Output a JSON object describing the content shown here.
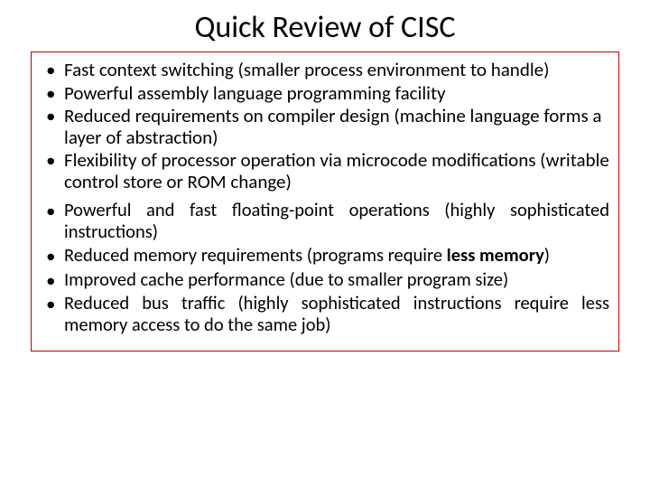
{
  "title": "Quick Review of CISC",
  "bullets_a": [
    "Fast context switching (smaller process environment to handle)",
    "Powerful assembly language programming facility",
    "Reduced requirements on compiler design (machine language forms a layer of abstraction)",
    "Flexibility of processor operation via microcode modifications (writable control store  or ROM change)"
  ],
  "bullets_b": [
    {
      "pre": "Powerful and fast floating-point operations (highly sophisticated instructions)",
      "bold": ""
    },
    {
      "pre": "Reduced memory requirements (programs require ",
      "bold": "less memory",
      "post": ")"
    },
    {
      "pre": "Improved cache performance (due to smaller program size)",
      "bold": ""
    },
    {
      "pre": "Reduced bus traffic (highly sophisticated instructions require less memory access to do the same job)",
      "bold": ""
    }
  ]
}
